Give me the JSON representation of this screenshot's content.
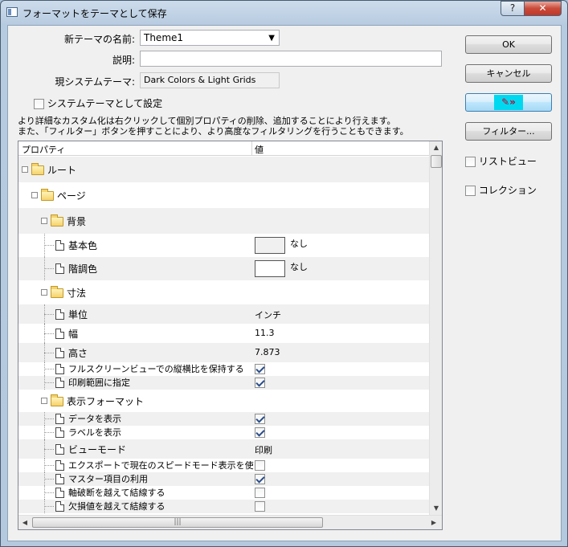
{
  "window": {
    "title": "フォーマットをテーマとして保存",
    "help_label": "?",
    "close_label": "✕"
  },
  "form": {
    "name_label": "新テーマの名前:",
    "name_value": "Theme1",
    "description_label": "説明:",
    "description_value": "",
    "system_theme_label": "現システムテーマ:",
    "system_theme_value": "Dark Colors & Light Grids",
    "set_system_theme_label": "システムテーマとして設定",
    "set_system_theme_checked": false,
    "description_line1": "より詳細なカスタム化は右クリックして個別プロパティの削除、追加することにより行えます。",
    "description_line2": "また、「フィルター」ボタンを押すことにより、より高度なフィルタリングを行うこともできます。"
  },
  "buttons": {
    "ok": "OK",
    "cancel": "キャンセル",
    "filter": "フィルター..."
  },
  "side_options": {
    "list_view": "リストビュー",
    "collection": "コレクション"
  },
  "grid": {
    "col_property": "プロパティ",
    "col_value": "値",
    "rows": [
      {
        "label": "ルート",
        "kind": "folder",
        "level": 0
      },
      {
        "label": "ページ",
        "kind": "folder",
        "level": 1
      },
      {
        "label": "背景",
        "kind": "folder",
        "level": 2
      },
      {
        "label": "基本色",
        "kind": "item",
        "level": 3,
        "value": "なし",
        "color_box": "#f0f0f0"
      },
      {
        "label": "階調色",
        "kind": "item",
        "level": 3,
        "value": "なし",
        "color_box": "#ffffff"
      },
      {
        "label": "寸法",
        "kind": "folder",
        "level": 2
      },
      {
        "label": "単位",
        "kind": "item",
        "level": 3,
        "value": "インチ"
      },
      {
        "label": "幅",
        "kind": "item",
        "level": 3,
        "value": "11.3"
      },
      {
        "label": "高さ",
        "kind": "item",
        "level": 3,
        "value": "7.873"
      },
      {
        "label": "フルスクリーンビューでの縦横比を保持する",
        "kind": "item",
        "level": 3,
        "check": true
      },
      {
        "label": "印刷範囲に指定",
        "kind": "item",
        "level": 3,
        "check": true
      },
      {
        "label": "表示フォーマット",
        "kind": "folder",
        "level": 2
      },
      {
        "label": "データを表示",
        "kind": "item",
        "level": 3,
        "check": true
      },
      {
        "label": "ラベルを表示",
        "kind": "item",
        "level": 3,
        "check": true
      },
      {
        "label": "ビューモード",
        "kind": "item",
        "level": 3,
        "value": "印刷"
      },
      {
        "label": "エクスポートで現在のスピードモード表示を使う",
        "kind": "item",
        "level": 3,
        "check": false
      },
      {
        "label": "マスター項目の利用",
        "kind": "item",
        "level": 3,
        "check": true
      },
      {
        "label": "軸破断を越えて結線する",
        "kind": "item",
        "level": 3,
        "check": false
      },
      {
        "label": "欠損値を越えて結線する",
        "kind": "item",
        "level": 3,
        "check": false
      }
    ],
    "hscroll_grip": "|||"
  },
  "icons": {
    "app": "window-icon",
    "folder": "folder-icon",
    "document": "document-icon",
    "theme_button": "pencil-chevron-icon"
  },
  "colors": {
    "title_bar": "#b9cde2",
    "dialog_bg": "#f0f0f0",
    "close_button": "#c94a38",
    "theme_button_bg": "#00d8f0"
  }
}
